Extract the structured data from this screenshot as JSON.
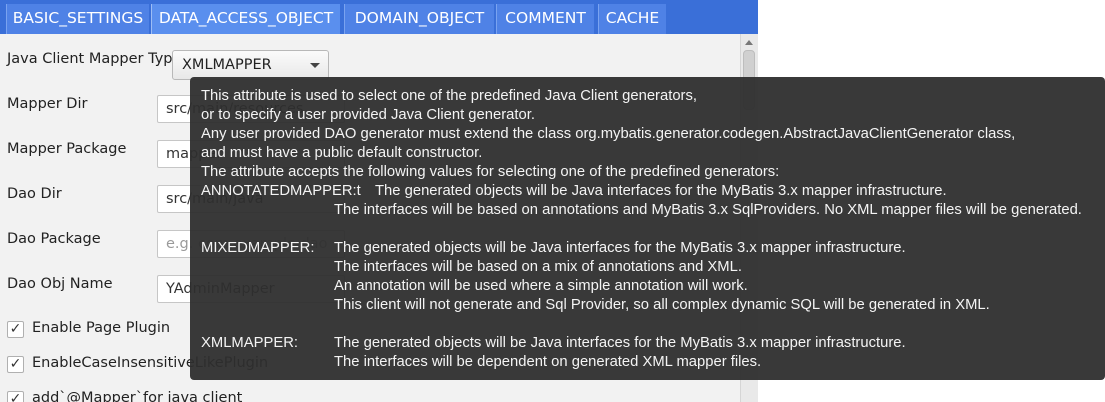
{
  "tabs": [
    {
      "label": "BASIC_SETTINGS"
    },
    {
      "label": "DATA_ACCESS_OBJECT"
    },
    {
      "label": "DOMAIN_OBJECT"
    },
    {
      "label": "COMMENT"
    },
    {
      "label": "CACHE"
    }
  ],
  "form": {
    "client_type_label": "Java Client Mapper Type",
    "client_type_value": "XMLMAPPER",
    "mapper_dir_label": "Mapper Dir",
    "mapper_dir_value": "src/main/resources",
    "mapper_package_label": "Mapper Package",
    "mapper_package_value": "mapper",
    "dao_dir_label": "Dao Dir",
    "dao_dir_value": "src/main/java",
    "dao_package_label": "Dao Package",
    "dao_package_placeholder": "e.g. com.example.dao",
    "dao_obj_name_label": "Dao Obj Name",
    "dao_obj_name_value": "YAdminMapper"
  },
  "checkboxes": [
    {
      "label": "Enable Page Plugin",
      "checked": true
    },
    {
      "label": "EnableCaseInsensitiveLikePlugin",
      "checked": true
    },
    {
      "label": "add`@Mapper`for java client",
      "checked": true
    }
  ],
  "tooltip": {
    "intro": [
      "This attribute is used to select one of the predefined Java Client generators,",
      "or to specify a user provided Java Client generator.",
      "Any user provided DAO generator must extend the class org.mybatis.generator.codegen.AbstractJavaClientGenerator class,",
      "and must have a public default constructor.",
      "The attribute accepts the following values for selecting one of the predefined generators:"
    ],
    "annotated_key": "ANNOTATEDMAPPER:t",
    "annotated_lines": [
      "The generated objects will be Java interfaces for the MyBatis 3.x mapper infrastructure.",
      "The interfaces will be based on annotations and MyBatis 3.x SqlProviders. No XML mapper files will be generated."
    ],
    "mixed_key": "MIXEDMAPPER:",
    "mixed_lines": [
      "The generated objects will be Java interfaces for the MyBatis 3.x mapper infrastructure.",
      "The interfaces will be based on a mix of annotations and XML.",
      "An annotation will be used where a simple annotation will work.",
      "This client will not generate and Sql Provider, so all complex dynamic SQL will be generated in XML."
    ],
    "xml_key": "XMLMAPPER:",
    "xml_lines": [
      "The generated objects will be Java interfaces for the MyBatis 3.x mapper infrastructure.",
      "The interfaces will be dependent on generated XML mapper files."
    ]
  },
  "colors": {
    "tab_bar": "#3a6fd8",
    "tooltip_bg": "#2e2e2e"
  },
  "icons": {
    "checkbox": "check-mark",
    "combo": "chevron-down-icon"
  }
}
